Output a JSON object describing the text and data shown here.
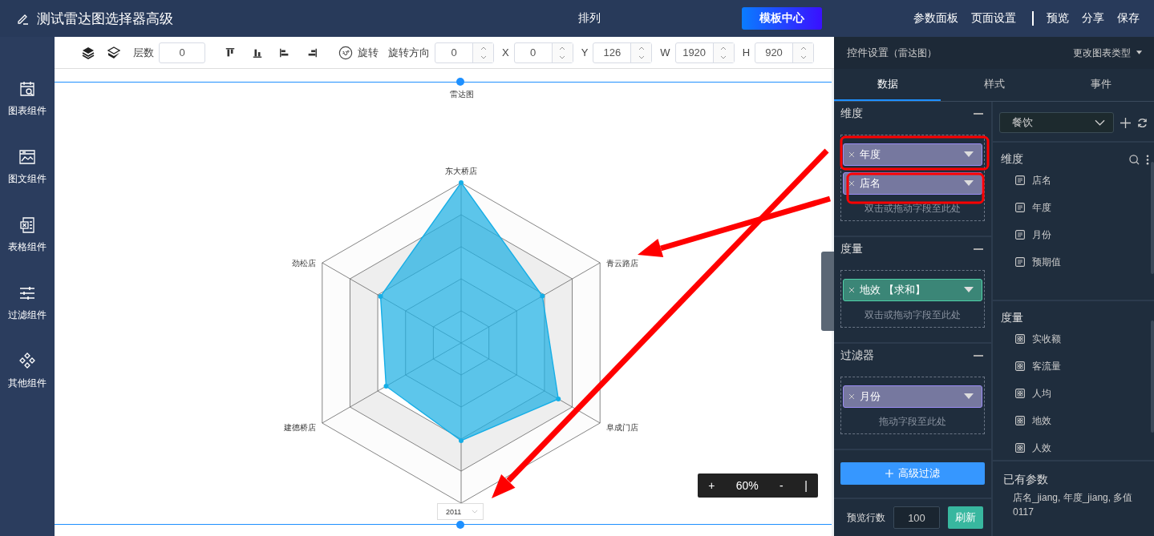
{
  "header": {
    "title": "测试雷达图选择器高级",
    "center_label": "排列",
    "template_button": "模板中心",
    "links": [
      "参数面板",
      "页面设置"
    ],
    "actions": [
      "预览",
      "分享",
      "保存"
    ]
  },
  "sidebar": {
    "items": [
      {
        "label": "图表组件",
        "kind": "chart"
      },
      {
        "label": "图文组件",
        "kind": "image"
      },
      {
        "label": "表格组件",
        "kind": "table"
      },
      {
        "label": "过滤组件",
        "kind": "filter"
      },
      {
        "label": "其他组件",
        "kind": "other"
      }
    ]
  },
  "toolbar": {
    "layer_label": "层数",
    "layer_value": "0",
    "rotate_label": "旋转",
    "rotate_dir_label": "旋转方向",
    "rotate_dir_value": "0",
    "coords": [
      {
        "label": "X",
        "value": "0"
      },
      {
        "label": "Y",
        "value": "126"
      },
      {
        "label": "W",
        "value": "1920"
      },
      {
        "label": "H",
        "value": "920"
      }
    ]
  },
  "canvas": {
    "chart_title": "雷达图",
    "axis_labels": [
      "东大桥店",
      "青云路店",
      "阜成门店",
      "建德桥店",
      "劲松店"
    ],
    "year_select": "2011",
    "zoom": {
      "zoom_in": "+",
      "level_text": "60%",
      "zoom_out": "-",
      "separator": "|"
    }
  },
  "panel": {
    "title": "控件设置",
    "subtitle": "（雷达图）",
    "change_type": "更改图表类型",
    "tabs": [
      {
        "label": "数据",
        "selected": true
      },
      {
        "label": "样式",
        "selected": false
      },
      {
        "label": "事件",
        "selected": false
      }
    ],
    "wells": [
      {
        "title": "维度",
        "fields": [
          {
            "label": "年度",
            "kind": "dimension"
          },
          {
            "label": "店名",
            "kind": "dimension"
          }
        ],
        "hint": "双击或拖动字段至此处"
      },
      {
        "title": "度量",
        "fields": [
          {
            "label": "地效 【求和】",
            "kind": "measure"
          }
        ],
        "hint": "双击或拖动字段至此处"
      },
      {
        "title": "过滤器",
        "fields": [
          {
            "label": "月份",
            "kind": "dimension"
          }
        ],
        "hint": "拖动字段至此处"
      }
    ],
    "advanced_filter": "高级过滤",
    "preview_rows_label": "预览行数",
    "preview_rows_value": "100",
    "refresh": "刷新",
    "dataset": "餐饮",
    "field_groups": [
      {
        "title": "维度",
        "kind": "dimension",
        "items": [
          "店名",
          "年度",
          "月份",
          "预期值"
        ]
      },
      {
        "title": "度量",
        "kind": "measure",
        "items": [
          "实收额",
          "客流量",
          "人均",
          "地效",
          "人效"
        ]
      }
    ],
    "params": {
      "title": "已有参数",
      "text": "店名_jiang, 年度_jiang, 多值0117"
    }
  }
}
